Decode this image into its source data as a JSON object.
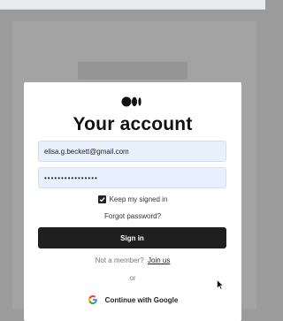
{
  "modal": {
    "title": "Your account",
    "email_value": "elisa.g.beckett@gmail.com",
    "password_value": "••••••••••••••••",
    "keep_signed_in_label": "Keep my signed in",
    "keep_signed_in_checked": true,
    "forgot_password_label": "Forgot password?",
    "sign_in_label": "Sign in",
    "not_member_text": "Not a member?",
    "join_label": "Join us",
    "or_text": "or",
    "google_label": "Continue with Google"
  },
  "icons": {
    "logo": "medium-logo-icon",
    "checkbox": "checkmark-icon",
    "google": "google-icon",
    "cursor": "mouse-cursor-icon"
  },
  "colors": {
    "backdrop": "#9b9b9b",
    "field_bg": "#e8f0fe",
    "button_bg": "#1f1f1f"
  }
}
